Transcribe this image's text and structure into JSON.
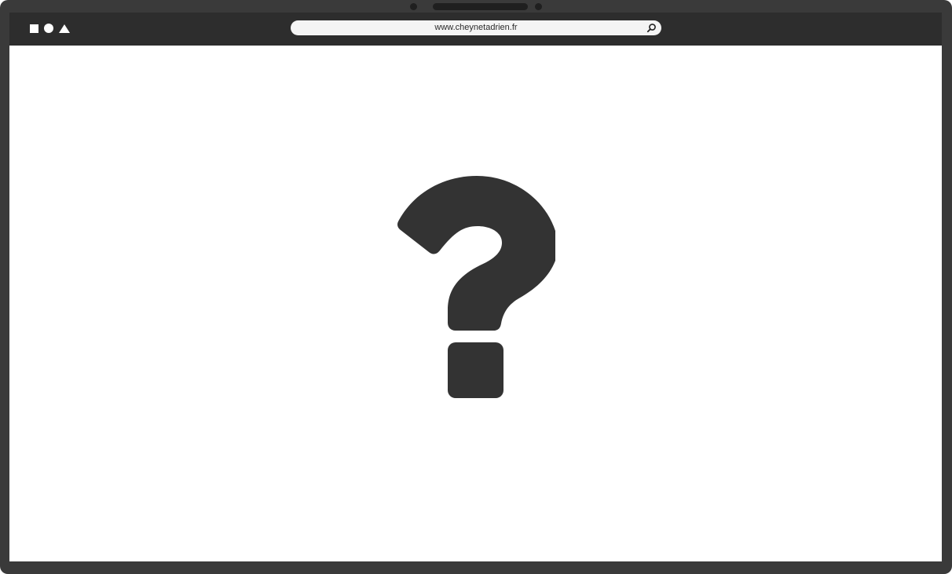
{
  "browser": {
    "url": "www.cheynetadrien.fr",
    "window_controls": [
      "square-icon",
      "circle-icon",
      "triangle-icon"
    ],
    "search_icon": "search-icon"
  },
  "page": {
    "illustration": "question-mark-icon"
  },
  "colors": {
    "frame": "#3a3a3a",
    "toolbar": "#2d2d2d",
    "urlbar": "#f4f4f4",
    "icon": "#333333",
    "background": "#ffffff"
  }
}
